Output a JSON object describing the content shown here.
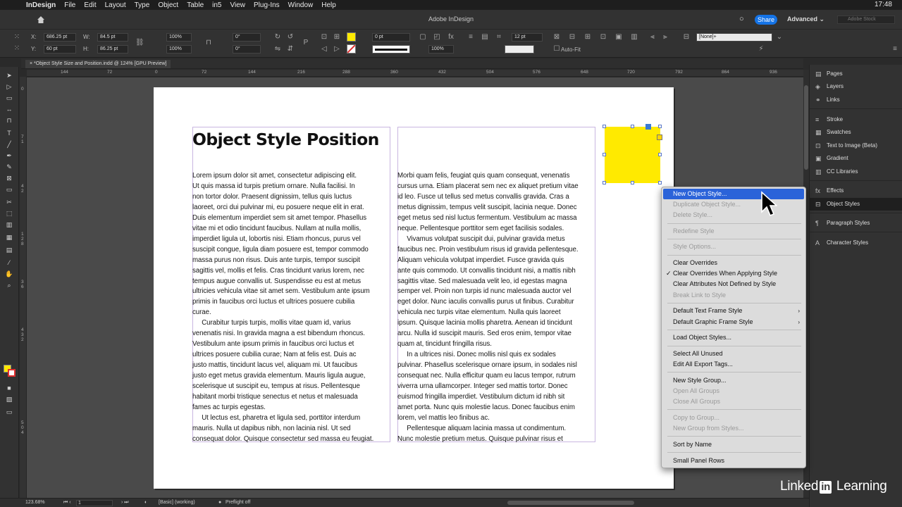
{
  "menubar": {
    "app": "InDesign",
    "items": [
      "File",
      "Edit",
      "Layout",
      "Type",
      "Object",
      "Table",
      "in5",
      "View",
      "Plug-Ins",
      "Window",
      "Help"
    ],
    "clock": "17:48"
  },
  "apptitle": {
    "title": "Adobe InDesign",
    "share": "Share",
    "workspace": "Advanced",
    "search_placeholder": "Adobe Stock"
  },
  "control": {
    "x_label": "X:",
    "x": "686.25 pt",
    "y_label": "Y:",
    "y": "60 pt",
    "w_label": "W:",
    "w": "84.5 pt",
    "h_label": "H:",
    "h": "86.25 pt",
    "scale_x": "100%",
    "scale_y": "100%",
    "angle": "0°",
    "shear": "0°",
    "stroke_weight": "0 pt",
    "opacity": "100%",
    "gutter": "12 pt",
    "autofit": "Auto-Fit",
    "object_style": "[None]+"
  },
  "doc": {
    "tab": "*Object Style Size and Position.indd @ 124% [GPU Preview]"
  },
  "ruler": {
    "h": [
      "144",
      "72",
      "0",
      "72",
      "144",
      "216",
      "288",
      "360",
      "432",
      "504",
      "576",
      "648",
      "720",
      "792",
      "864",
      "936"
    ],
    "v": [
      "0",
      "7",
      "1",
      "4",
      "2",
      "1",
      "2",
      "8",
      "3",
      "6",
      "4",
      "3",
      "2",
      "5",
      "0",
      "4"
    ]
  },
  "content": {
    "heading": "Object Style Position",
    "col1": "Lorem ipsum dolor sit amet, consectetur adipiscing elit.\nUt quis massa id turpis pretium ornare. Nulla facilisi. In\nnon tortor dolor. Praesent dignissim, tellus quis luctus\nlaoreet, orci dui pulvinar mi, eu posuere neque elit in erat.\nDuis elementum imperdiet sem sit amet tempor. Phasellus\nvitae mi et odio tincidunt faucibus. Nullam at nulla mollis,\nimperdiet ligula ut, lobortis nisi. Etiam rhoncus, purus vel\nsuscipit congue, ligula diam posuere est, tempor commodo\nmassa purus non risus. Duis ante turpis, tempor suscipit\nsagittis vel, mollis et felis. Cras tincidunt varius lorem, nec\ntempus augue convallis ut. Suspendisse eu est at metus\nultricies vehicula vitae sit amet sem. Vestibulum ante ipsum\nprimis in faucibus orci luctus et ultrices posuere cubilia\ncurae.\n     Curabitur turpis turpis, mollis vitae quam id, varius\nvenenatis nisi. In gravida magna a est bibendum rhoncus.\nVestibulum ante ipsum primis in faucibus orci luctus et\nultrices posuere cubilia curae; Nam at felis est. Duis ac\njusto mattis, tincidunt lacus vel, aliquam mi. Ut faucibus\njusto eget metus gravida elementum. Mauris ligula augue,\nscelerisque ut suscipit eu, tempus at risus. Pellentesque\nhabitant morbi tristique senectus et netus et malesuada\nfames ac turpis egestas.\n     Ut lectus est, pharetra et ligula sed, porttitor interdum\nmauris. Nulla ut dapibus nibh, non lacinia nisl. Ut sed\nconsequat dolor. Quisque consectetur sed massa eu feugiat.",
    "col2": "Morbi quam felis, feugiat quis quam consequat, venenatis\ncursus urna. Etiam placerat sem nec ex aliquet pretium vitae\nid leo. Fusce ut tellus sed metus convallis gravida. Cras a\nmetus dignissim, tempus velit suscipit, lacinia neque. Donec\neget metus sed nisl luctus fermentum. Vestibulum ac massa\nneque. Pellentesque porttitor sem eget facilisis sodales.\n     Vivamus volutpat suscipit dui, pulvinar gravida metus\nfaucibus nec. Proin vestibulum risus id gravida pellentesque.\nAliquam vehicula volutpat imperdiet. Fusce gravida quis\nante quis commodo. Ut convallis tincidunt nisi, a mattis nibh\nsagittis vitae. Sed malesuada velit leo, id egestas magna\nsemper vel. Proin non turpis id nunc malesuada auctor vel\neget dolor. Nunc iaculis convallis purus ut finibus. Curabitur\nvehicula nec turpis vitae elementum. Nulla quis laoreet\nipsum. Quisque lacinia mollis pharetra. Aenean id tincidunt\narcu. Nulla id suscipit mauris. Sed eros enim, tempor vitae\nquam at, tincidunt fringilla risus.\n     In a ultrices nisi. Donec mollis nisl quis ex sodales\npulvinar. Phasellus scelerisque ornare ipsum, in sodales nisl\nconsequat nec. Nulla efficitur quam eu lacus tempor, rutrum\nviverra urna ullamcorper. Integer sed mattis tortor. Donec\neuismod fringilla imperdiet. Vestibulum dictum id nibh sit\namet porta. Nunc quis molestie lacus. Donec faucibus enim\nlorem, vel mattis leo finibus ac.\n     Pellentesque aliquam lacinia massa ut condimentum.\nNunc molestie pretium metus. Quisque pulvinar risus et"
  },
  "panels": [
    {
      "label": "Pages",
      "icon": "pages-icon"
    },
    {
      "label": "Layers",
      "icon": "layers-icon"
    },
    {
      "label": "Links",
      "icon": "links-icon"
    },
    {
      "label": "Stroke",
      "icon": "stroke-icon"
    },
    {
      "label": "Swatches",
      "icon": "swatches-icon"
    },
    {
      "label": "Text to Image (Beta)",
      "icon": "text-to-image-icon"
    },
    {
      "label": "Gradient",
      "icon": "gradient-icon"
    },
    {
      "label": "CC Libraries",
      "icon": "cc-libraries-icon"
    },
    {
      "label": "Effects",
      "icon": "effects-icon"
    },
    {
      "label": "Object Styles",
      "icon": "object-styles-icon"
    },
    {
      "label": "Paragraph Styles",
      "icon": "paragraph-styles-icon"
    },
    {
      "label": "Character Styles",
      "icon": "character-styles-icon"
    }
  ],
  "menu": {
    "items": [
      {
        "label": "New Object Style...",
        "state": "highlighted"
      },
      {
        "label": "Duplicate Object Style...",
        "state": "disabled"
      },
      {
        "label": "Delete Style...",
        "state": "disabled"
      },
      {
        "label": "Redefine Style",
        "state": "disabled"
      },
      {
        "label": "Style Options...",
        "state": "disabled"
      },
      {
        "label": "Clear Overrides",
        "state": "enabled"
      },
      {
        "label": "Clear Overrides When Applying Style",
        "state": "checked"
      },
      {
        "label": "Clear Attributes Not Defined by Style",
        "state": "enabled"
      },
      {
        "label": "Break Link to Style",
        "state": "disabled"
      },
      {
        "label": "Default Text Frame Style",
        "state": "submenu"
      },
      {
        "label": "Default Graphic Frame Style",
        "state": "submenu"
      },
      {
        "label": "Load Object Styles...",
        "state": "enabled"
      },
      {
        "label": "Select All Unused",
        "state": "enabled"
      },
      {
        "label": "Edit All Export Tags...",
        "state": "enabled"
      },
      {
        "label": "New Style Group...",
        "state": "enabled"
      },
      {
        "label": "Open All Groups",
        "state": "disabled"
      },
      {
        "label": "Close All Groups",
        "state": "disabled"
      },
      {
        "label": "Copy to Group...",
        "state": "disabled"
      },
      {
        "label": "New Group from Styles...",
        "state": "disabled"
      },
      {
        "label": "Sort by Name",
        "state": "enabled"
      },
      {
        "label": "Small Panel Rows",
        "state": "enabled"
      }
    ]
  },
  "status": {
    "zoom": "123.68%",
    "page": "1",
    "mode": "[Basic] (working)",
    "preflight": "Preflight off"
  },
  "watermark": {
    "brand_a": "Linked",
    "brand_in": "in",
    "brand_b": "Learning"
  },
  "colors": {
    "fill": "#ffea00",
    "highlight": "#2b63d9",
    "share": "#1473e6"
  }
}
